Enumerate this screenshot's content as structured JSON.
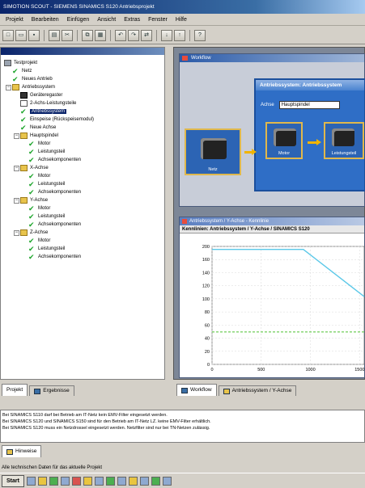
{
  "window": {
    "title": "SIMOTION SCOUT - SIEMENS SINAMICS S120 Antriebsprojekt"
  },
  "menu": [
    "Projekt",
    "Bearbeiten",
    "Einfügen",
    "Ansicht",
    "Extras",
    "Fenster",
    "Hilfe"
  ],
  "toolbar_icons": [
    "new-icon",
    "open-icon",
    "save-icon",
    "print-icon",
    "cut-icon",
    "copy-icon",
    "paste-icon",
    "undo-icon",
    "redo-icon",
    "connect-icon",
    "download-icon",
    "upload-icon",
    "help-icon"
  ],
  "tree": {
    "root": "Testprojekt",
    "items": [
      {
        "label": "Testprojekt",
        "icon": "root",
        "level": 0
      },
      {
        "label": "Netz",
        "icon": "check",
        "level": 1
      },
      {
        "label": "Neues Antrieb",
        "icon": "check",
        "level": 1
      },
      {
        "label": "Antriebssystem",
        "icon": "folder",
        "level": 1
      },
      {
        "label": "Geräteregaster",
        "icon": "dev",
        "level": 2
      },
      {
        "label": "2-Achs-Leistungsteile",
        "icon": "doc",
        "level": 2
      },
      {
        "label": "Antriebssystem",
        "icon": "check",
        "level": 2,
        "selected": true
      },
      {
        "label": "Einspeise (Rückspeisemodul)",
        "icon": "check",
        "level": 2
      },
      {
        "label": "Neue Achse",
        "icon": "check",
        "level": 2
      },
      {
        "label": "Hauptspindel",
        "icon": "folder",
        "level": 2
      },
      {
        "label": "Motor",
        "icon": "check",
        "level": 3
      },
      {
        "label": "Leistungsteil",
        "icon": "check",
        "level": 3
      },
      {
        "label": "Achsekomponenten",
        "icon": "check",
        "level": 3
      },
      {
        "label": "X-Achse",
        "icon": "folder",
        "level": 2
      },
      {
        "label": "Motor",
        "icon": "check",
        "level": 3
      },
      {
        "label": "Leistungsteil",
        "icon": "check",
        "level": 3
      },
      {
        "label": "Achsekomponenten",
        "icon": "check",
        "level": 3
      },
      {
        "label": "Y-Achse",
        "icon": "folder",
        "level": 2
      },
      {
        "label": "Motor",
        "icon": "check",
        "level": 3
      },
      {
        "label": "Leistungsteil",
        "icon": "check",
        "level": 3
      },
      {
        "label": "Achsekomponenten",
        "icon": "check",
        "level": 3
      },
      {
        "label": "Z-Achse",
        "icon": "folder",
        "level": 2
      },
      {
        "label": "Motor",
        "icon": "check",
        "level": 3
      },
      {
        "label": "Leistungsteil",
        "icon": "check",
        "level": 3
      },
      {
        "label": "Achsekomponenten",
        "icon": "check",
        "level": 3
      }
    ]
  },
  "left_tabs": {
    "projekt": "Projekt",
    "ergebnisse": "Ergebnisse"
  },
  "workflow": {
    "title": "Workflow",
    "inner_title": "Antriebssystem: Antriebssystem",
    "field_label": "Achse",
    "field_value": "Hauptspindel",
    "nodes": [
      "Netz",
      "Motor",
      "Leistungsteil"
    ]
  },
  "chart": {
    "window_title": "Antriebssystem / Y-Achse - Kennlinie",
    "subtitle": "Kennlinien: Antriebssystem / Y-Achse / SINAMICS S120",
    "y_ticks": [
      "200",
      "160",
      "140",
      "120",
      "100",
      "80",
      "60",
      "40",
      "20",
      "0"
    ],
    "x_ticks": [
      "0",
      "500",
      "1000",
      "1500"
    ]
  },
  "chart_data": {
    "type": "line",
    "ylim": [
      0,
      200
    ],
    "xlim": [
      0,
      2000
    ],
    "series": [
      {
        "color": "#5bc8e8",
        "x": [
          0,
          1200,
          2000
        ],
        "y": [
          195,
          195,
          115
        ]
      },
      {
        "color": "#7ed26a",
        "x": [
          0,
          2000
        ],
        "y": [
          55,
          55
        ]
      }
    ],
    "grid": true
  },
  "right_tabs": {
    "workflow": "Workflow",
    "antrieb": "Antriebssystem / Y-Achse"
  },
  "output_lines": [
    "Bei SINAMICS S110 darf bei Betrieb am IT-Netz kein EMV-Filter eingesetzt werden.",
    "Bei SINAMICS S120 und SINAMICS S150 sind für den Betrieb am IT-Netz LZ. keine EMV-Filter erhältlich.",
    "Bei SINAMICS S120 muss ein Netzdrossel eingesetzt werden. Netzfilter sind nur bei TN-Netzen zulässig."
  ],
  "bottom_tab": "Hinweise",
  "status_text": "Alle technischen Daten für das aktuelle Projekt",
  "taskbar": {
    "start": "Start"
  }
}
